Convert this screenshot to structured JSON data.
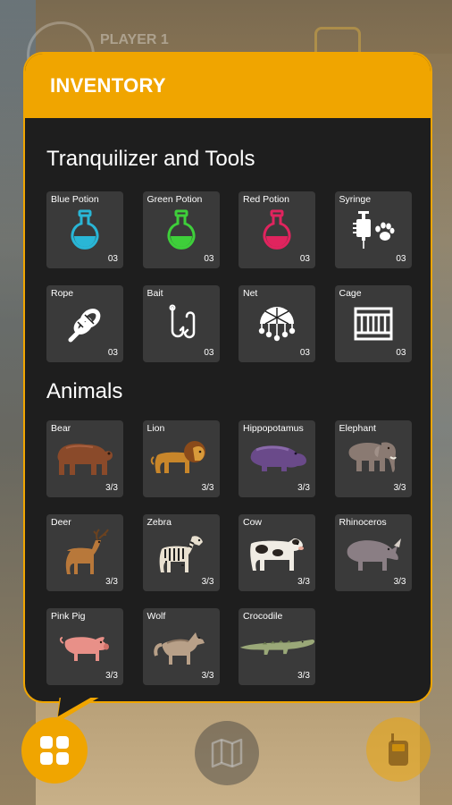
{
  "background": {
    "player_label": "PLAYER 1"
  },
  "inventory": {
    "title": "INVENTORY",
    "tools_section": {
      "title": "Tranquilizer and Tools",
      "items": [
        {
          "label": "Blue Potion",
          "count": "03",
          "icon": "blue-potion-icon",
          "color": "#29b6d6"
        },
        {
          "label": "Green Potion",
          "count": "03",
          "icon": "green-potion-icon",
          "color": "#3ecf3a"
        },
        {
          "label": "Red Potion",
          "count": "03",
          "icon": "red-potion-icon",
          "color": "#e0245e"
        },
        {
          "label": "Syringe",
          "count": "03",
          "icon": "syringe-icon",
          "color": "#ffffff"
        },
        {
          "label": "Rope",
          "count": "03",
          "icon": "rope-icon",
          "color": "#ffffff"
        },
        {
          "label": "Bait",
          "count": "03",
          "icon": "bait-hook-icon",
          "color": "#ffffff"
        },
        {
          "label": "Net",
          "count": "03",
          "icon": "net-icon",
          "color": "#ffffff"
        },
        {
          "label": "Cage",
          "count": "03",
          "icon": "cage-icon",
          "color": "#ffffff"
        }
      ]
    },
    "animals_section": {
      "title": "Animals",
      "items": [
        {
          "label": "Bear",
          "count": "3/3",
          "icon": "bear-icon",
          "color": "#8a4a2a"
        },
        {
          "label": "Lion",
          "count": "3/3",
          "icon": "lion-icon",
          "color": "#c8862a"
        },
        {
          "label": "Hippopotamus",
          "count": "3/3",
          "icon": "hippo-icon",
          "color": "#6a4a8a"
        },
        {
          "label": "Elephant",
          "count": "3/3",
          "icon": "elephant-icon",
          "color": "#8a7a72"
        },
        {
          "label": "Deer",
          "count": "3/3",
          "icon": "deer-icon",
          "color": "#b8783a"
        },
        {
          "label": "Zebra",
          "count": "3/3",
          "icon": "zebra-icon",
          "color": "#e8e0d0"
        },
        {
          "label": "Cow",
          "count": "3/3",
          "icon": "cow-icon",
          "color": "#f0ece4"
        },
        {
          "label": "Rhinoceros",
          "count": "3/3",
          "icon": "rhino-icon",
          "color": "#8a7e84"
        },
        {
          "label": "Pink Pig",
          "count": "3/3",
          "icon": "pig-icon",
          "color": "#e89088"
        },
        {
          "label": "Wolf",
          "count": "3/3",
          "icon": "wolf-icon",
          "color": "#b8a088"
        },
        {
          "label": "Crocodile",
          "count": "3/3",
          "icon": "crocodile-icon",
          "color": "#9aa878"
        }
      ]
    }
  },
  "bottom_bar": {
    "menu_icon": "grid-menu-icon",
    "map_icon": "map-icon",
    "radio_icon": "walkie-talkie-icon",
    "accent": "#f0a500"
  }
}
